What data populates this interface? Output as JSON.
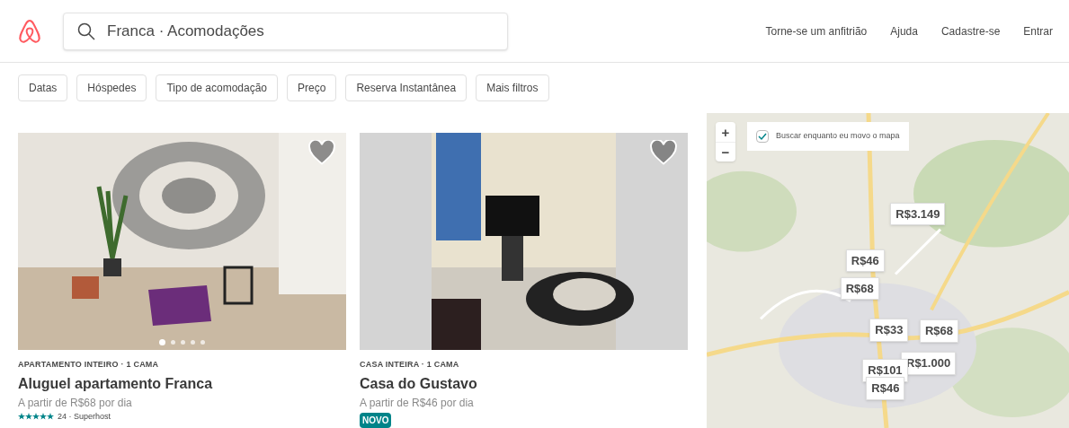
{
  "header": {
    "search": {
      "value": "Franca · Acomodações"
    },
    "nav": [
      "Torne-se um anfitrião",
      "Ajuda",
      "Cadastre-se",
      "Entrar"
    ]
  },
  "filters": [
    "Datas",
    "Hóspedes",
    "Tipo de acomodação",
    "Preço",
    "Reserva Instantânea",
    "Mais filtros"
  ],
  "listings": [
    {
      "kind": "apartment",
      "type": "APARTAMENTO INTEIRO · 1 CAMA",
      "title": "Aluguel apartamento Franca",
      "price": "A partir de R$68 por dia",
      "stars": 5,
      "reviews": "24 · Superhost",
      "favorite": false,
      "photo_dots": [
        {
          "selected": true
        },
        {
          "selected": false
        },
        {
          "selected": false
        },
        {
          "selected": false
        },
        {
          "selected": false
        }
      ]
    },
    {
      "kind": "house",
      "type": "CASA INTEIRA · 1 CAMA",
      "title": "Casa do Gustavo",
      "price": "A partir de R$46 por dia",
      "badge": "NOVO",
      "favorite": false
    }
  ],
  "map": {
    "zoom_in": "+",
    "zoom_out": "−",
    "search_as_move": {
      "label": "Buscar enquanto eu movo o mapa",
      "checked": true
    },
    "pins": [
      {
        "label": "R$3.149"
      },
      {
        "label": "R$46"
      },
      {
        "label": "R$68"
      },
      {
        "label": "R$33"
      },
      {
        "label": "R$68"
      },
      {
        "label": "R$1.000"
      },
      {
        "label": "R$101"
      },
      {
        "label": "R$46"
      }
    ]
  }
}
